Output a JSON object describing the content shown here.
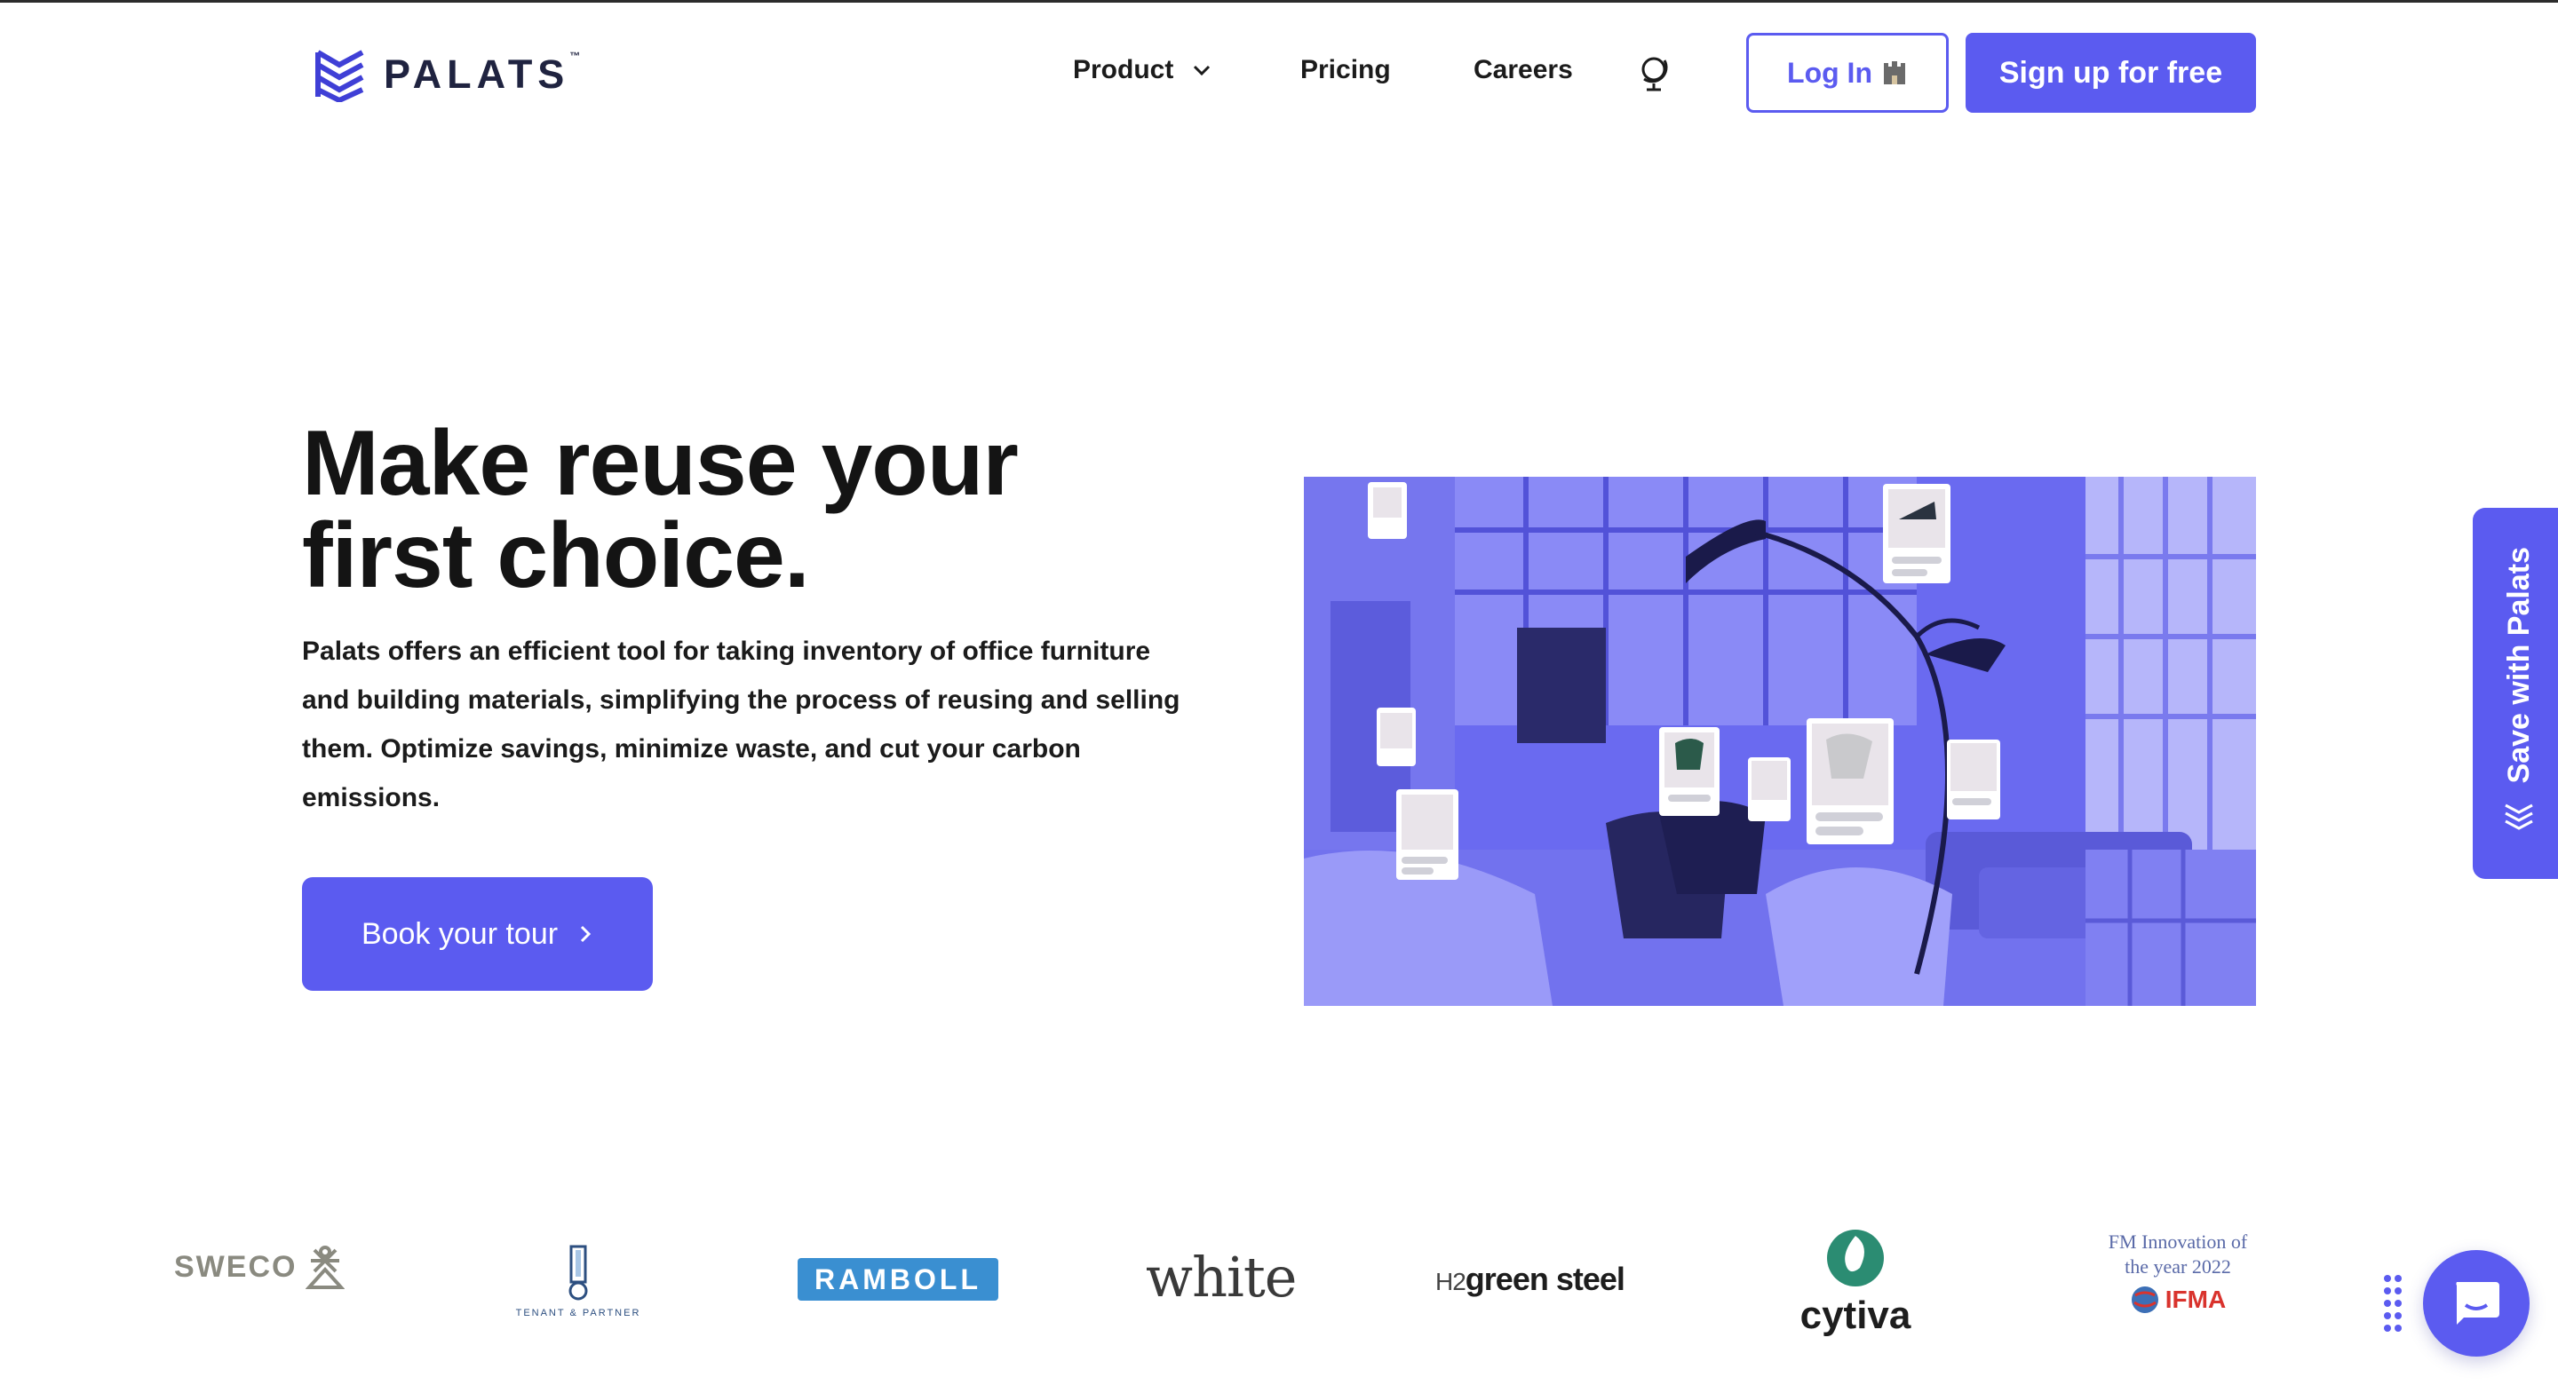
{
  "brand": {
    "name": "PALATS",
    "trademark": "™",
    "accent": "#5b5bf0"
  },
  "nav": {
    "product": "Product",
    "pricing": "Pricing",
    "careers": "Careers",
    "language_icon": "globe-icon"
  },
  "auth": {
    "login": "Log In",
    "signup": "Sign up for free"
  },
  "hero": {
    "title": "Make reuse your first choice.",
    "description": "Palats offers an efficient tool for taking inventory of office furniture and building materials, simplifying the process of reusing and selling them. Optimize savings, minimize waste, and cut your carbon emissions.",
    "cta": "Book your tour"
  },
  "side_tab": {
    "label": "Save with Palats"
  },
  "clients": {
    "sweco": "SWECO",
    "tenant_partner": "TENANT & PARTNER",
    "ramboll": "RAMBOLL",
    "white": "white",
    "h2": "H2",
    "green_steel": "green steel",
    "cytiva": "cytiva",
    "award_line1": "FM Innovation of",
    "award_line2": "the year 2022",
    "ifma": "IFMA"
  }
}
